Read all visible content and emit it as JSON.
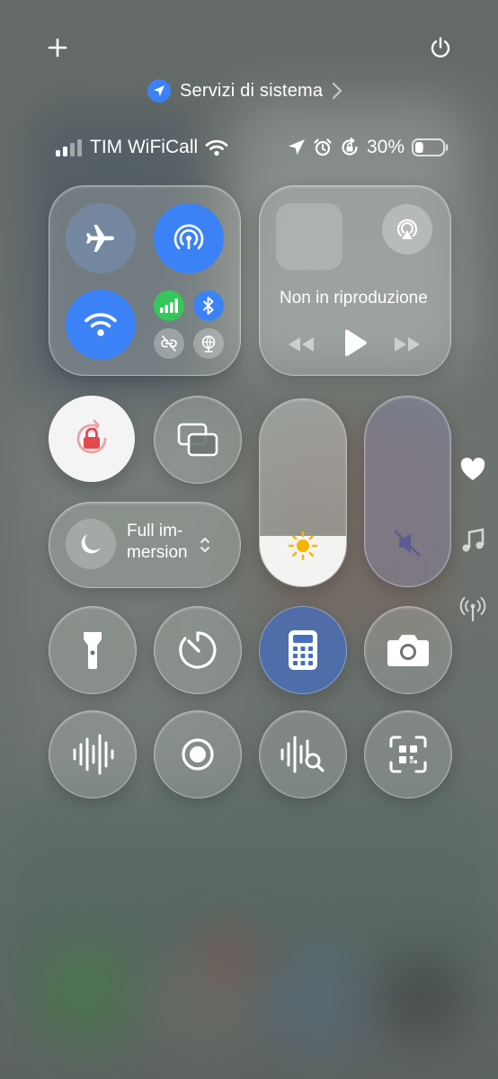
{
  "header": {
    "add_icon": "plus-icon",
    "power_icon": "power-icon",
    "location_label": "Servizi di sistema",
    "location_icon": "location-arrow-icon"
  },
  "status_bar": {
    "carrier": "TIM WiFiCall",
    "battery_percent": "30%",
    "battery_level": 0.3,
    "icons": [
      "signal-bars-icon",
      "wifi-icon",
      "location-icon",
      "alarm-icon",
      "rotation-lock-icon",
      "battery-icon"
    ]
  },
  "connectivity": {
    "airplane_icon": "airplane-icon",
    "hotspot_icon": "hotspot-icon",
    "wifi_icon": "wifi-icon",
    "cellular_icon": "cellular-icon",
    "bluetooth_icon": "bluetooth-icon",
    "link_icon": "link-icon",
    "vpn_icon": "globe-icon",
    "colors": {
      "active": "#3b82f6",
      "cellular": "#35c759"
    }
  },
  "media": {
    "now_playing": "Non in riproduzione",
    "airplay_icon": "airplay-icon",
    "controls": [
      "rewind-icon",
      "play-icon",
      "fast-forward-icon"
    ]
  },
  "controls": {
    "rotation_lock_icon": "rotation-lock-icon",
    "screen_mirroring_icon": "screen-mirroring-icon",
    "focus_label_line1": "Full im-",
    "focus_label_line2": "mersion",
    "focus_icon": "moon-icon",
    "brightness_icon": "sun-icon",
    "brightness_level": 0.27,
    "volume_icon": "speaker-muted-icon",
    "volume_level": 0.0
  },
  "side_indicators": [
    "heart-icon",
    "music-note-icon",
    "antenna-icon"
  ],
  "apps_row1": [
    "flashlight-icon",
    "timer-icon",
    "calculator-icon",
    "camera-icon"
  ],
  "apps_row2": [
    "sound-recognition-icon",
    "screen-record-icon",
    "voice-search-icon",
    "qr-scanner-icon"
  ]
}
